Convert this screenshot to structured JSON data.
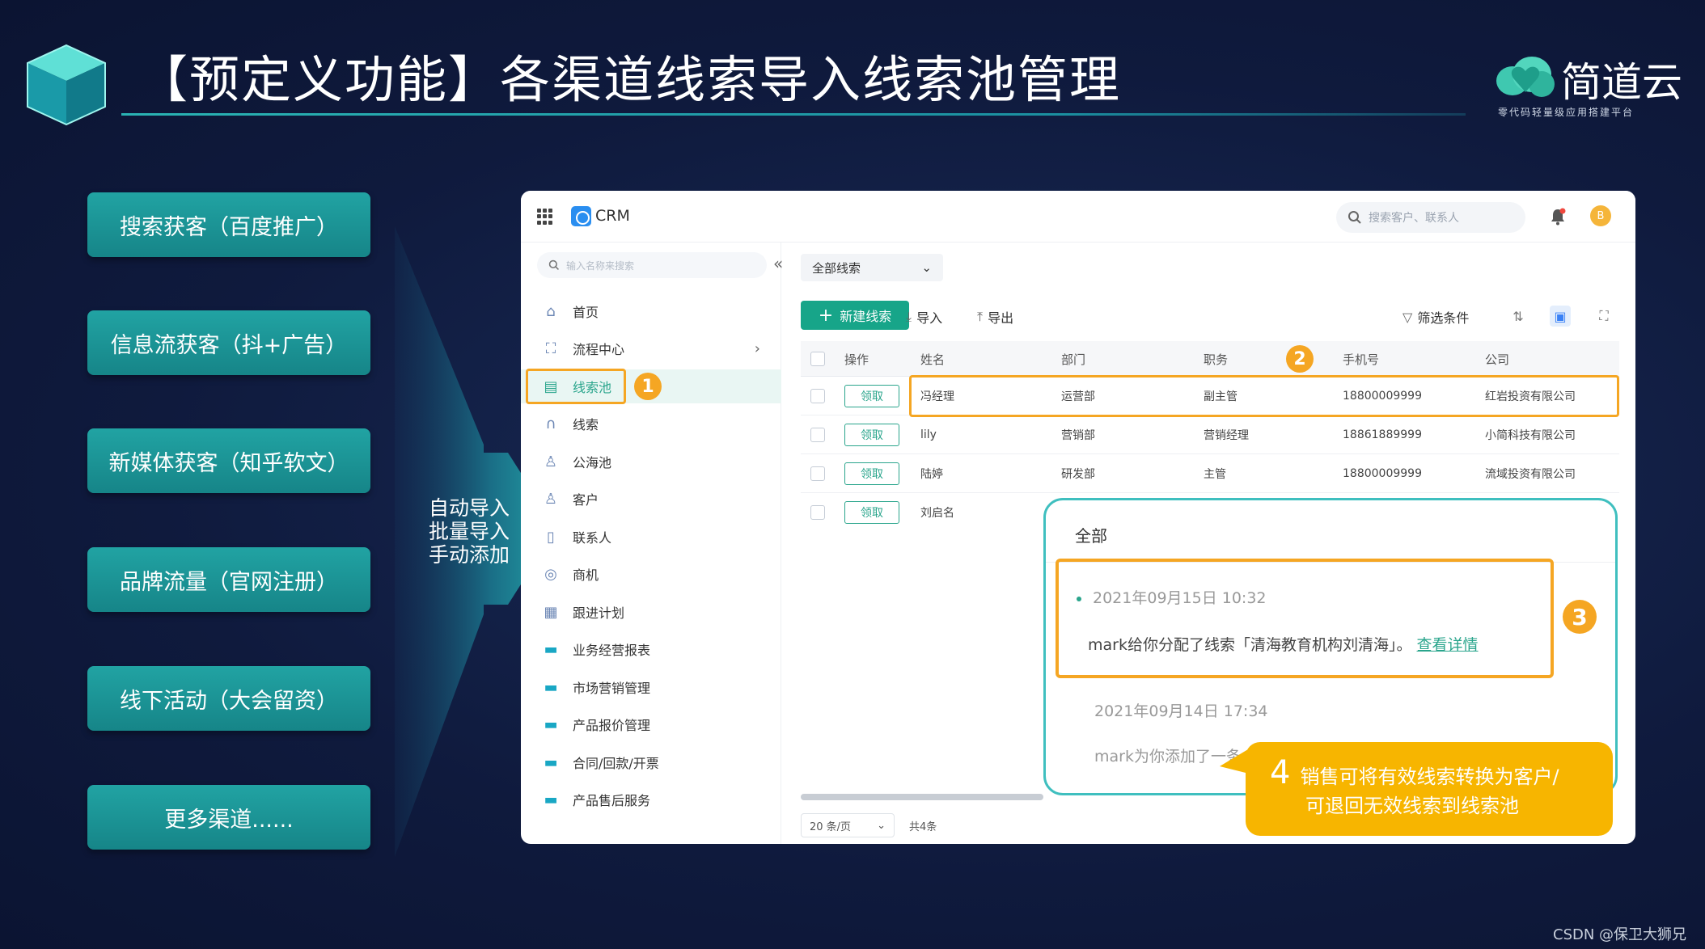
{
  "slide": {
    "title": "【预定义功能】各渠道线索导入线索池管理",
    "watermark": "CSDN @保卫大狮兄"
  },
  "logo": {
    "name": "简道云",
    "tagline": "零代码轻量级应用搭建平台"
  },
  "channels": [
    "搜索获客（百度推广）",
    "信息流获客（抖+广告）",
    "新媒体获客（知乎软文）",
    "品牌流量（官网注册）",
    "线下活动（大会留资）",
    "更多渠道......"
  ],
  "import_methods": [
    "自动导入",
    "批量导入",
    "手动添加"
  ],
  "app": {
    "name": "CRM",
    "search_placeholder": "搜索客户、联系人",
    "avatar_initial": "B"
  },
  "sidebar": {
    "search_placeholder": "输入名称来搜索",
    "items": [
      {
        "label": "首页",
        "icon": "home-icon"
      },
      {
        "label": "流程中心",
        "icon": "flow-icon"
      },
      {
        "label": "线索池",
        "icon": "pool-icon"
      },
      {
        "label": "线索",
        "icon": "lead-icon"
      },
      {
        "label": "公海池",
        "icon": "public-pool-icon"
      },
      {
        "label": "客户",
        "icon": "customer-icon"
      },
      {
        "label": "联系人",
        "icon": "contact-icon"
      },
      {
        "label": "商机",
        "icon": "opportunity-icon"
      },
      {
        "label": "跟进计划",
        "icon": "calendar-icon"
      },
      {
        "label": "业务经营报表",
        "icon": "folder-icon"
      },
      {
        "label": "市场营销管理",
        "icon": "folder-icon"
      },
      {
        "label": "产品报价管理",
        "icon": "folder-icon"
      },
      {
        "label": "合同/回款/开票",
        "icon": "folder-icon"
      },
      {
        "label": "产品售后服务",
        "icon": "folder-icon"
      }
    ],
    "active_index": 2
  },
  "toolbar": {
    "filter_select": "全部线索",
    "new_button": "新建线索",
    "import": "导入",
    "export": "导出",
    "filter_conditions": "筛选条件"
  },
  "table": {
    "columns": [
      "操作",
      "姓名",
      "部门",
      "职务",
      "手机号",
      "公司"
    ],
    "rows": [
      {
        "action": "领取",
        "name": "冯经理",
        "dept": "运营部",
        "title": "副主管",
        "phone": "18800009999",
        "company": "红岩投资有限公司"
      },
      {
        "action": "领取",
        "name": "lily",
        "dept": "营销部",
        "title": "营销经理",
        "phone": "18861889999",
        "company": "小简科技有限公司"
      },
      {
        "action": "领取",
        "name": "陆婷",
        "dept": "研发部",
        "title": "主管",
        "phone": "18800009999",
        "company": "流域投资有限公司"
      },
      {
        "action": "领取",
        "name": "刘启名",
        "dept": "",
        "title": "",
        "phone": "",
        "company": ""
      }
    ]
  },
  "pager": {
    "page_size": "20 条/页",
    "total": "共4条"
  },
  "notification": {
    "tab": "全部",
    "items": [
      {
        "time": "2021年09月15日 10:32",
        "text": "mark给你分配了线索「清海教育机构刘清海」。",
        "link": "查看详情"
      },
      {
        "time": "2021年09月14日 17:34",
        "text": "mark为你添加了一条",
        "link": ""
      }
    ]
  },
  "badges": [
    "1",
    "2",
    "3"
  ],
  "callout": {
    "number": "4",
    "line1": "销售可将有效线索转换为客户/",
    "line2": "可退回无效线索到线索池"
  },
  "colors": {
    "background": "#0f1a3d",
    "teal": "#17a589",
    "highlight": "#f5a623",
    "callout": "#f7b500"
  }
}
